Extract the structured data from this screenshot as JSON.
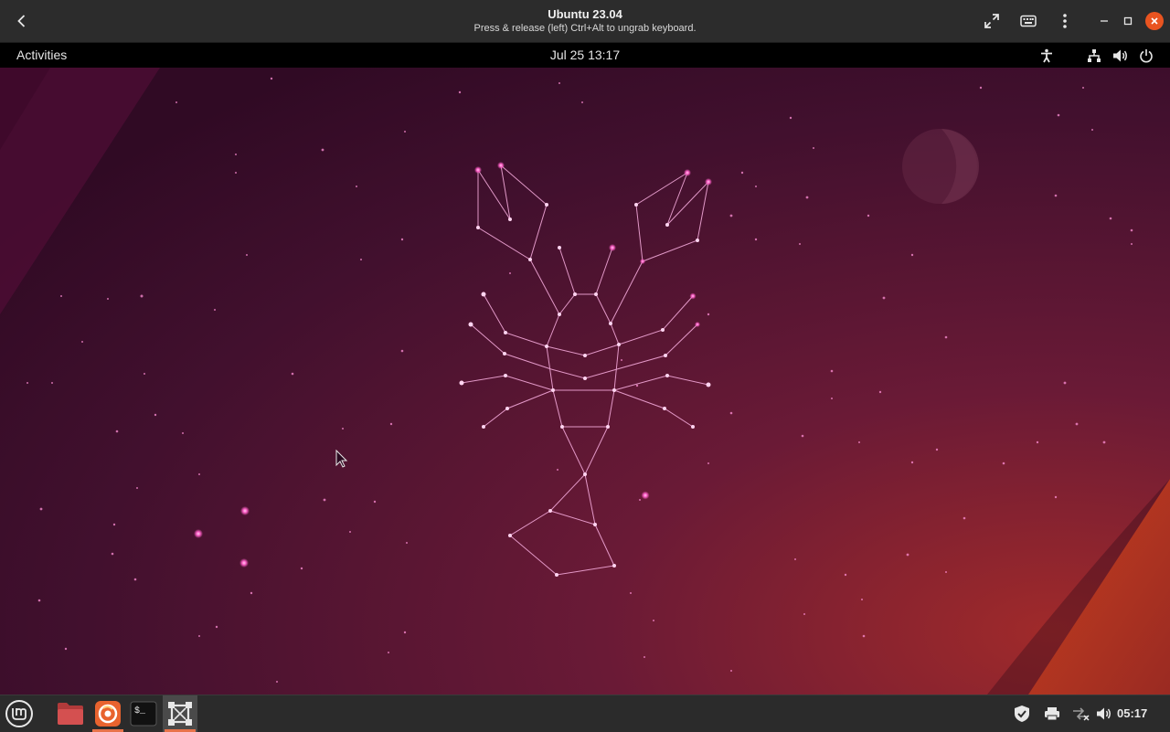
{
  "viewer": {
    "title": "Ubuntu 23.04",
    "subtitle": "Press & release (left) Ctrl+Alt to ungrab keyboard.",
    "buttons": [
      "back-icon",
      "fullscreen-icon",
      "keyboard-icon",
      "menu-icon",
      "minimize-icon",
      "maximize-icon",
      "close-icon"
    ]
  },
  "gnome_panel": {
    "activities": "Activities",
    "clock": "Jul 25  13:17",
    "status_icons": [
      "accessibility-icon",
      "network-icon",
      "volume-icon",
      "power-icon"
    ]
  },
  "taskbar": {
    "apps": [
      {
        "name": "mint-menu-icon"
      },
      {
        "name": "file-manager-icon"
      },
      {
        "name": "firefox-icon",
        "active": true
      },
      {
        "name": "terminal-icon",
        "label": "$_"
      },
      {
        "name": "virt-viewer-icon",
        "active": true,
        "focused": true
      }
    ],
    "tray": [
      "shield-icon",
      "printer-icon",
      "network-disconnected-icon",
      "volume-icon"
    ],
    "clock": "05:17"
  },
  "colors": {
    "accent": "#e95420",
    "wallpaper_base": "#3a0c2a",
    "taskbar_highlight": "#e8734a"
  }
}
